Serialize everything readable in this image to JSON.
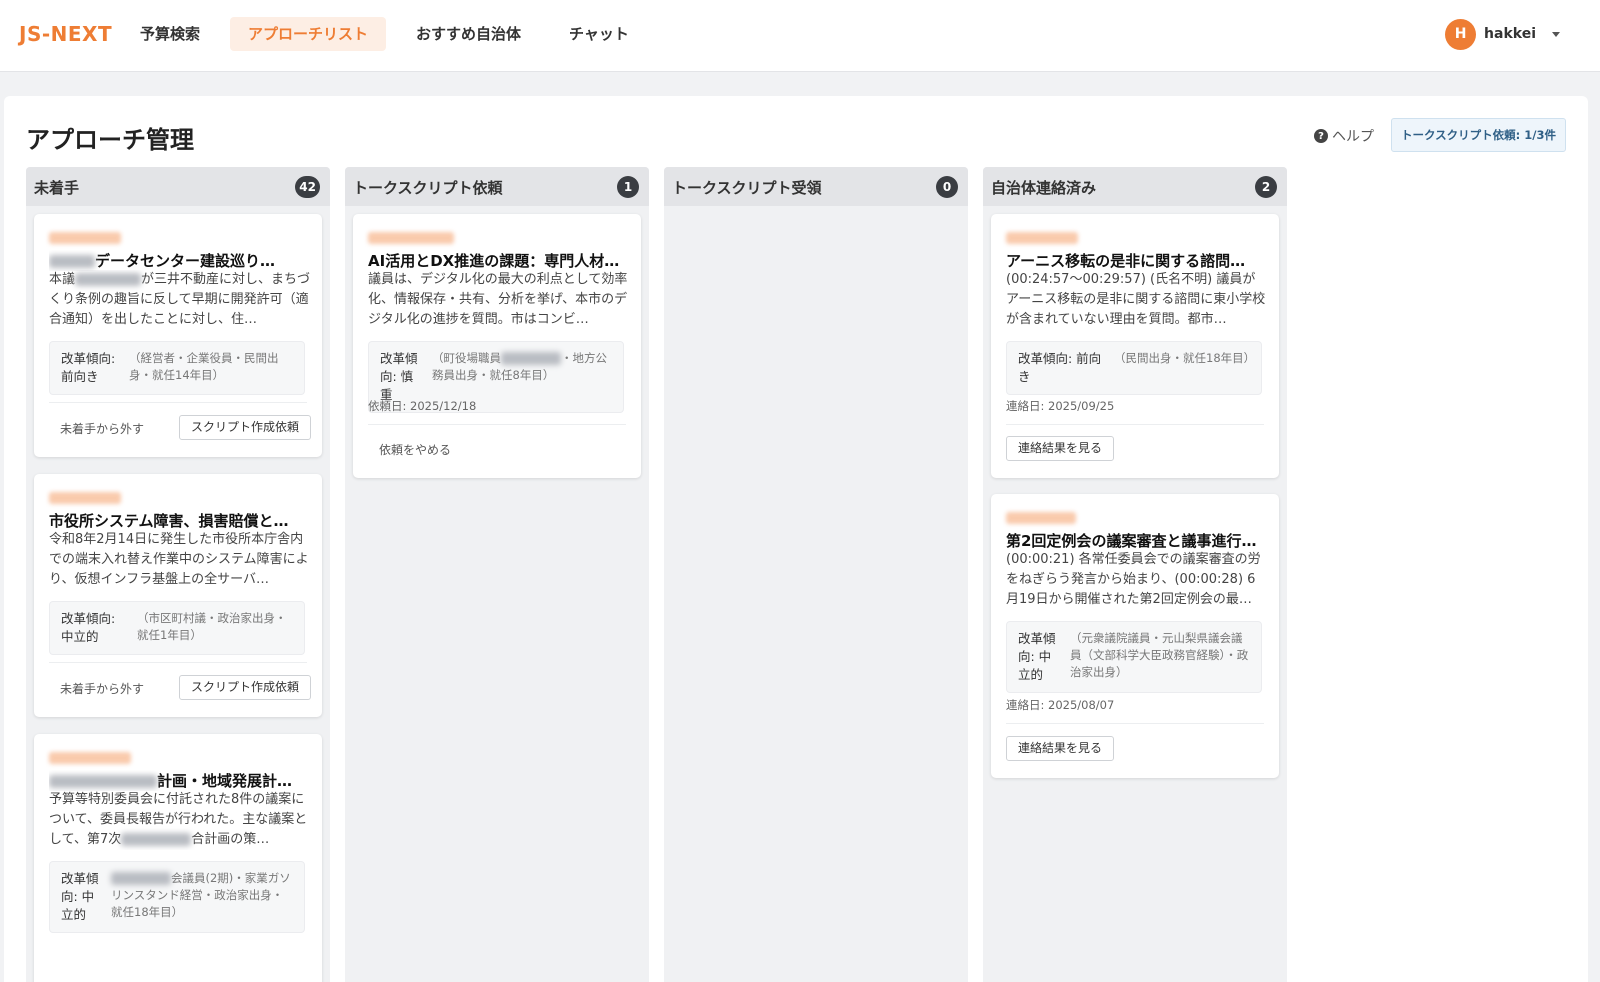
{
  "header": {
    "logo": "JS-NEXT",
    "nav": [
      {
        "label": "予算検索"
      },
      {
        "label": "アプローチリスト"
      },
      {
        "label": "おすすめ自治体"
      },
      {
        "label": "チャット"
      }
    ],
    "user": {
      "initial": "H",
      "name": "hakkei"
    }
  },
  "page": {
    "title": "アプローチ管理",
    "help_label": "ヘルプ",
    "script_quota": "トークスクリプト依頼: 1/3件"
  },
  "columns": [
    {
      "title": "未着手",
      "count": "42",
      "cards": [
        {
          "title": "データセンター建設巡り…",
          "summary_visible": "本議",
          "summary_rest": "が三井不動産に対し、まちづくり条例の趣旨に反して早期に開発許可（適合通知）を出したことに対し、住…",
          "reform_label": "改革傾向: 前向き",
          "reform_detail": "（経営者・企業役員・民間出身・就任14年目）",
          "secondary_action": "未着手から外す",
          "primary_action": "スクリプト作成依頼"
        },
        {
          "title": "市役所システム障害、損害賠償と…",
          "summary": "令和8年2月14日に発生した市役所本庁舎内での端末入れ替え作業中のシステム障害により、仮想インフラ基盤上の全サーバ…",
          "reform_label": "改革傾向: 中立的",
          "reform_detail": "（市区町村議・政治家出身・就任1年目）",
          "secondary_action": "未着手から外す",
          "primary_action": "スクリプト作成依頼"
        },
        {
          "title": "計画・地域発展計…",
          "summary_a": "予算等特別委員会に付託された8件の議案について、委員長報告が行われた。主な議案として、第7次",
          "summary_b": "合計画の策…",
          "reform_label": "改革傾向: 中立的",
          "reform_detail": "会議員(2期)・家業ガソリンスタンド経営・政治家出身・就任18年目）"
        }
      ]
    },
    {
      "title": "トークスクリプト依頼",
      "count": "1",
      "cards": [
        {
          "title": "AI活用とDX推進の課題：専門人材…",
          "summary": "議員は、デジタル化の最大の利点として効率化、情報保存・共有、分析を挙げ、本市のデジタル化の進捗を質問。市はコンビ…",
          "reform_label": "改革傾向: 慎重",
          "reform_detail_a": "（町役場職員",
          "reform_detail_b": "・地方公務員出身・就任8年目）",
          "date": "依頼日: 2025/12/18",
          "secondary_action": "依頼をやめる"
        }
      ]
    },
    {
      "title": "トークスクリプト受領",
      "count": "0",
      "cards": []
    },
    {
      "title": "自治体連絡済み",
      "count": "2",
      "cards": [
        {
          "title": "アーニス移転の是非に関する諮問…",
          "summary": "(00:24:57〜00:29:57) (氏名不明) 議員がアーニス移転の是非に関する諮問に東小学校が含まれていない理由を質問。都市…",
          "reform_label": "改革傾向: 前向き",
          "reform_detail": "（民間出身・就任18年目）",
          "date": "連絡日: 2025/09/25",
          "action": "連絡結果を見る"
        },
        {
          "title": "第2回定例会の議案審査と議事進行…",
          "summary": "(00:00:21) 各常任委員会での議案審査の労をねぎらう発言から始まり、(00:00:28) 6月19日から開催された第2回定例会の最…",
          "reform_label": "改革傾向: 中立的",
          "reform_detail": "（元衆議院議員・元山梨県議会議員（文部科学大臣政務官経験）・政治家出身）",
          "date": "連絡日: 2025/08/07",
          "action": "連絡結果を見る"
        }
      ]
    }
  ],
  "colors": {
    "accent": "#ee7d34",
    "badge": "#3a3d42"
  }
}
